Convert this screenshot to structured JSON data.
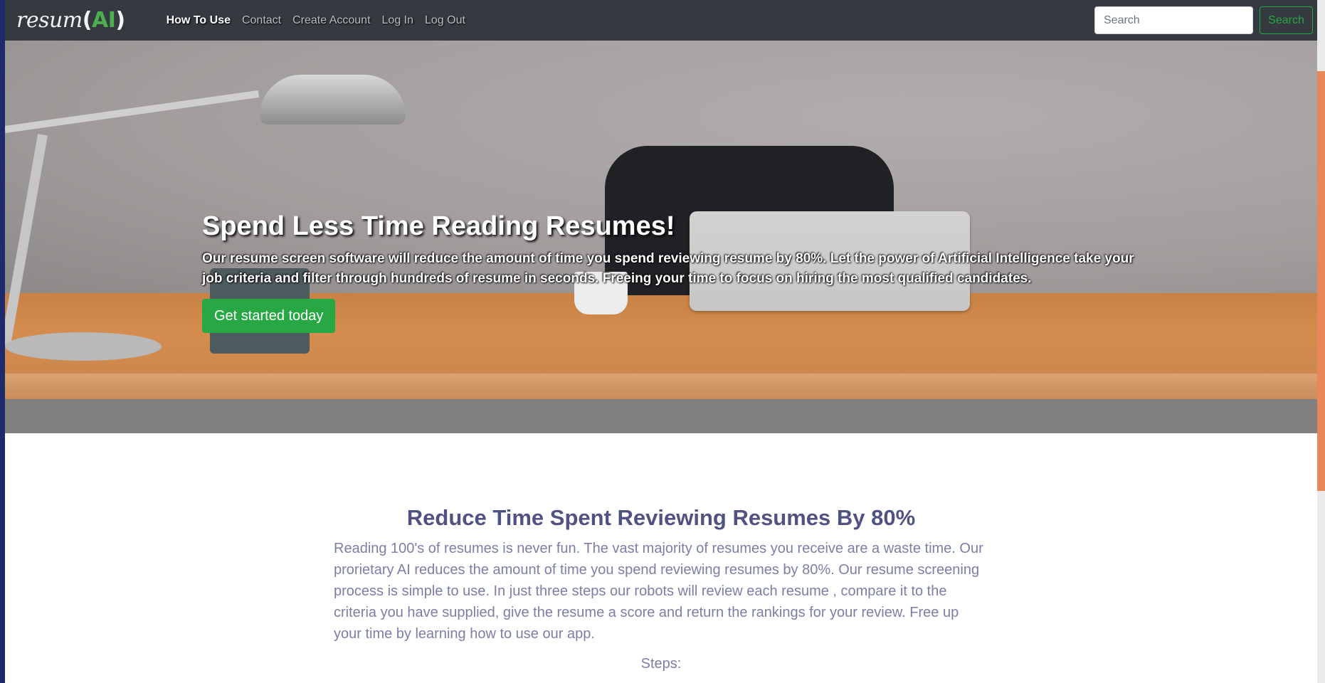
{
  "nav": {
    "brand_text": "resum",
    "brand_paren_open": "(",
    "brand_ai": "AI",
    "brand_paren_close": ")",
    "links": [
      {
        "label": "How To Use"
      },
      {
        "label": "Contact"
      },
      {
        "label": "Create Account"
      },
      {
        "label": "Log In"
      },
      {
        "label": "Log Out"
      }
    ],
    "search_placeholder": "Search",
    "search_button": "Search"
  },
  "hero": {
    "title": "Spend Less Time Reading Resumes!",
    "subtitle": "Our resume screen software will reduce the amount of time you spend reviewing resume by 80%. Let the power of Artificial Intelligence take your job criteria and filter through hundreds of resume in seconds. Freeing your time to focus on hiring the most qualified candidates.",
    "cta": "Get started today"
  },
  "main": {
    "title": "Reduce Time Spent Reviewing Resumes By 80%",
    "paragraph": "Reading 100's of resumes is never fun. The vast majority of resumes you receive are a waste time. Our prorietary AI reduces the amount of time you spend reviewing resumes by 80%. Our resume screening process is simple to use. In just three steps our robots will review each resume , compare it to the criteria you have supplied, give the resume a score and return the rankings for your review. Free up your time by learning how to use our app.",
    "steps_label": "Steps:"
  },
  "colors": {
    "navbar": "#343a40",
    "accent_green": "#28a745",
    "heading_text": "#4f5382",
    "body_text": "#7b7fa6"
  }
}
